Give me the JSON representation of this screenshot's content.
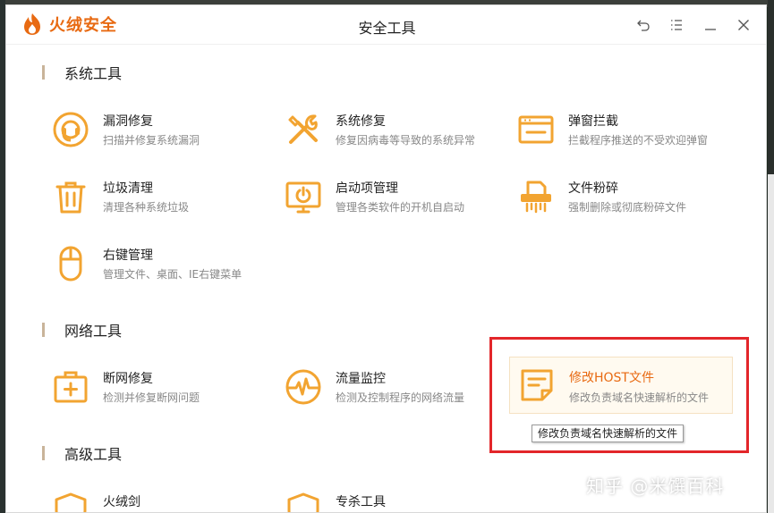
{
  "app": {
    "logo_text": "火绒安全",
    "window_title": "安全工具"
  },
  "colors": {
    "accent": "#e86a12",
    "icon": "#f2a431",
    "highlight": "#e3262a"
  },
  "sections": {
    "system": {
      "title": "系统工具",
      "items": [
        {
          "name": "漏洞修复",
          "desc": "扫描并修复系统漏洞",
          "icon": "vulnerability-repair-icon"
        },
        {
          "name": "系统修复",
          "desc": "修复因病毒等导致的系统异常",
          "icon": "wrench-screwdriver-icon"
        },
        {
          "name": "弹窗拦截",
          "desc": "拦截程序推送的不受欢迎弹窗",
          "icon": "popup-window-icon"
        },
        {
          "name": "垃圾清理",
          "desc": "清理各种系统垃圾",
          "icon": "trash-can-icon"
        },
        {
          "name": "启动项管理",
          "desc": "管理各类软件的开机自启动",
          "icon": "startup-monitor-icon"
        },
        {
          "name": "文件粉碎",
          "desc": "强制删除或彻底粉碎文件",
          "icon": "file-shredder-icon"
        },
        {
          "name": "右键管理",
          "desc": "管理文件、桌面、IE右键菜单",
          "icon": "mouse-icon"
        }
      ]
    },
    "network": {
      "title": "网络工具",
      "items": [
        {
          "name": "断网修复",
          "desc": "检测并修复断网问题",
          "icon": "first-aid-kit-icon"
        },
        {
          "name": "流量监控",
          "desc": "检测及控制程序的网络流量",
          "icon": "pulse-gauge-icon"
        },
        {
          "name": "修改HOST文件",
          "desc": "修改负责域名快速解析的文件",
          "icon": "note-edit-icon"
        }
      ]
    },
    "advanced": {
      "title": "高级工具",
      "items": [
        {
          "name": "火绒剑",
          "icon": "shield-icon"
        },
        {
          "name": "专杀工具",
          "icon": "shield-icon"
        }
      ]
    }
  },
  "tooltip": "修改负责域名快速解析的文件",
  "watermark": "知乎 @米馔百科"
}
